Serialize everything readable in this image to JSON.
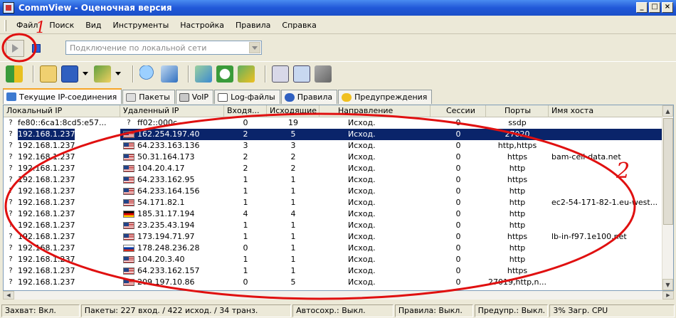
{
  "window": {
    "title": "CommView - Оценочная версия"
  },
  "menu": [
    "Файл",
    "Поиск",
    "Вид",
    "Инструменты",
    "Настройка",
    "Правила",
    "Справка"
  ],
  "connection": {
    "placeholder": "Подключение по локальной сети"
  },
  "tabs": [
    {
      "label": "Текущие IP-соединения",
      "icon": "network-icon"
    },
    {
      "label": "Пакеты",
      "icon": "packets-icon"
    },
    {
      "label": "VoIP",
      "icon": "voip-icon"
    },
    {
      "label": "Log-файлы",
      "icon": "log-icon"
    },
    {
      "label": "Правила",
      "icon": "rules-icon"
    },
    {
      "label": "Предупреждения",
      "icon": "alerts-icon"
    }
  ],
  "table": {
    "columns": [
      "Локальный IP",
      "Удаленный IP",
      "Входя...",
      "Исходящие",
      "Направление",
      "Сессии",
      "Порты",
      "Имя хоста"
    ],
    "rows": [
      {
        "local": "fe80::6ca1:8cd5:e57...",
        "flag": "q",
        "remote": "ff02::000c",
        "in": "0",
        "out": "19",
        "dir": "Исход.",
        "sess": "0",
        "ports": "ssdp",
        "host": ""
      },
      {
        "local": "192.168.1.237",
        "flag": "us",
        "remote": "162.254.197.40",
        "in": "2",
        "out": "5",
        "dir": "Исход.",
        "sess": "0",
        "ports": "27020",
        "host": "",
        "selected": true
      },
      {
        "local": "192.168.1.237",
        "flag": "us",
        "remote": "64.233.163.136",
        "in": "3",
        "out": "3",
        "dir": "Исход.",
        "sess": "0",
        "ports": "http,https",
        "host": ""
      },
      {
        "local": "192.168.1.237",
        "flag": "us",
        "remote": "50.31.164.173",
        "in": "2",
        "out": "2",
        "dir": "Исход.",
        "sess": "0",
        "ports": "https",
        "host": "bam-cell-data.net"
      },
      {
        "local": "192.168.1.237",
        "flag": "us",
        "remote": "104.20.4.17",
        "in": "2",
        "out": "2",
        "dir": "Исход.",
        "sess": "0",
        "ports": "http",
        "host": ""
      },
      {
        "local": "192.168.1.237",
        "flag": "us",
        "remote": "64.233.162.95",
        "in": "1",
        "out": "1",
        "dir": "Исход.",
        "sess": "0",
        "ports": "https",
        "host": ""
      },
      {
        "local": "192.168.1.237",
        "flag": "us",
        "remote": "64.233.164.156",
        "in": "1",
        "out": "1",
        "dir": "Исход.",
        "sess": "0",
        "ports": "http",
        "host": ""
      },
      {
        "local": "192.168.1.237",
        "flag": "us",
        "remote": "54.171.82.1",
        "in": "1",
        "out": "1",
        "dir": "Исход.",
        "sess": "0",
        "ports": "http",
        "host": "ec2-54-171-82-1.eu-west..."
      },
      {
        "local": "192.168.1.237",
        "flag": "de",
        "remote": "185.31.17.194",
        "in": "4",
        "out": "4",
        "dir": "Исход.",
        "sess": "0",
        "ports": "http",
        "host": ""
      },
      {
        "local": "192.168.1.237",
        "flag": "us",
        "remote": "23.235.43.194",
        "in": "1",
        "out": "1",
        "dir": "Исход.",
        "sess": "0",
        "ports": "http",
        "host": ""
      },
      {
        "local": "192.168.1.237",
        "flag": "us",
        "remote": "173.194.71.97",
        "in": "1",
        "out": "1",
        "dir": "Исход.",
        "sess": "0",
        "ports": "https",
        "host": "lb-in-f97.1e100.net"
      },
      {
        "local": "192.168.1.237",
        "flag": "ru",
        "remote": "178.248.236.28",
        "in": "0",
        "out": "1",
        "dir": "Исход.",
        "sess": "0",
        "ports": "http",
        "host": ""
      },
      {
        "local": "192.168.1.237",
        "flag": "us",
        "remote": "104.20.3.40",
        "in": "1",
        "out": "1",
        "dir": "Исход.",
        "sess": "0",
        "ports": "http",
        "host": ""
      },
      {
        "local": "192.168.1.237",
        "flag": "us",
        "remote": "64.233.162.157",
        "in": "1",
        "out": "1",
        "dir": "Исход.",
        "sess": "0",
        "ports": "https",
        "host": ""
      },
      {
        "local": "192.168.1.237",
        "flag": "us",
        "remote": "209.197.10.86",
        "in": "0",
        "out": "5",
        "dir": "Исход.",
        "sess": "0",
        "ports": "27019,http,n...",
        "host": ""
      }
    ]
  },
  "status": {
    "capture": "Захват: Вкл.",
    "packets": "Пакеты: 227 вход. / 422 исход. / 34 транз.",
    "autosave": "Автосохр.: Выкл.",
    "rules": "Правила: Выкл.",
    "alerts": "Предупр.: Выкл.",
    "cpu": "3% Загр. CPU"
  },
  "annotations": {
    "mark1": "1",
    "mark2": "2"
  },
  "colors": {
    "title_bar": "#2158d8",
    "selection": "#0a246a",
    "annotation": "#e01010"
  }
}
